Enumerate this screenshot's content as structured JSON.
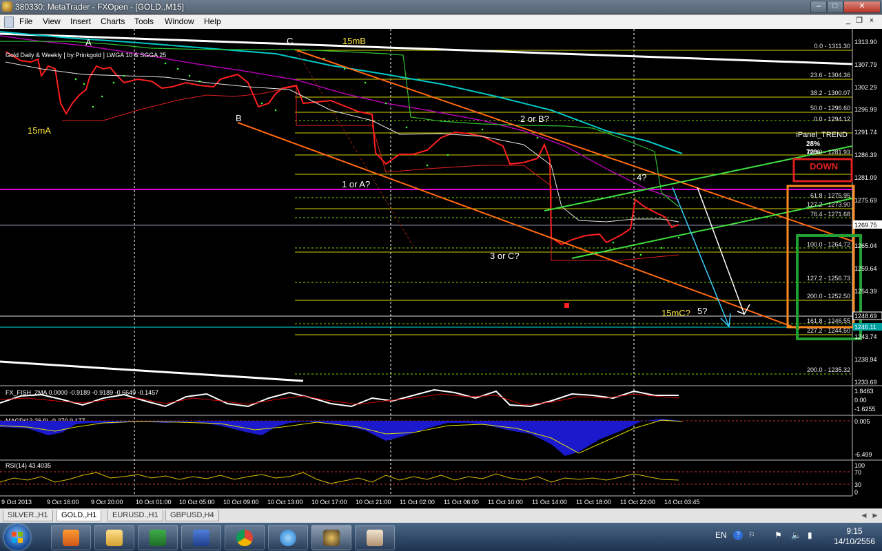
{
  "window": {
    "title": "380330: MetaTrader - FXOpen - [GOLD.,M15]",
    "min": "–",
    "max": "□",
    "close": "✕",
    "mdi_min": "_",
    "mdi_restore": "❐",
    "mdi_close": "×"
  },
  "menu": [
    "File",
    "View",
    "Insert",
    "Charts",
    "Tools",
    "Window",
    "Help"
  ],
  "chart": {
    "info": "Gold Daily & Weekly [ by:Prinkgold ] LWGA 10  & SGGA 25",
    "price_labels": [
      "1313.90",
      "1307.79",
      "1302.29",
      "1296.99",
      "1291.74",
      "1286.39",
      "1281.09",
      "1275.69",
      "1269.75",
      "1265.04",
      "1259.64",
      "1254.39",
      "1248.69",
      "1246.11",
      "1243.74",
      "1238.94",
      "1233.69"
    ],
    "current_price": "1269.75",
    "fib_labels": [
      "0.0 - 1311.30",
      "23.6 - 1304.36",
      "38.2 - 1300.07",
      "50.0 - 1296.60",
      "0.0 - 1294.12",
      "100.0 - 1281.93",
      "61.8 - 1275.95",
      "127.2 - 1273.90",
      "76.4 - 1271.68",
      "100.0 - 1264.72",
      "127.2 - 1256.73",
      "200.0 - 1252.50",
      "161.8 - 1246.55",
      "227.2 - 1244.50",
      "200.0 - 1235.32"
    ],
    "wave_labels": {
      "A": "A",
      "B": "B",
      "C": "C",
      "m15A": "15mA",
      "m15B": "15mB",
      "one_or_A": "1 or A?",
      "two_or_B": "2 or B?",
      "three_or_C": "3 or C?",
      "four": "4?",
      "m15C": "15mC?",
      "five": "5?"
    },
    "ipanel": {
      "title": "iPanel_TREND",
      "line1": "28%",
      "line2": "72%",
      "badge": "DOWN"
    },
    "time_labels": [
      "9 Oct 2013",
      "9 Oct 16:00",
      "9 Oct 20:00",
      "10 Oct 01:00",
      "10 Oct 05:00",
      "10 Oct 09:00",
      "10 Oct 13:00",
      "10 Oct 17:00",
      "10 Oct 21:00",
      "11 Oct 02:00",
      "11 Oct 06:00",
      "11 Oct 10:00",
      "11 Oct 14:00",
      "11 Oct 18:00",
      "11 Oct 22:00",
      "14 Oct 03:45"
    ],
    "indicators": {
      "fisher": {
        "label": "FX_FISH_2MA 0.0000 -0.9189 -0.9189 -0.6649 -0.1457",
        "ticks": [
          "1.8463",
          "0.00",
          "-1.6255"
        ]
      },
      "macd": {
        "label": "MACD(12,26,9) -0.270 0.177",
        "ticks": [
          "0.005",
          "-6.499"
        ]
      },
      "rsi": {
        "label": "RSI(14) 43.4035",
        "ticks": [
          "100",
          "70",
          "30",
          "0"
        ]
      }
    }
  },
  "tabs": [
    {
      "label": "SILVER.,H1",
      "active": false
    },
    {
      "label": "GOLD.,H1",
      "active": true
    },
    {
      "label": "EURUSD.,H1",
      "active": false
    },
    {
      "label": "GBPUSD,H4",
      "active": false
    }
  ],
  "tab_arrows": {
    "left": "◀",
    "right": "▶"
  },
  "taskbar": {
    "apps": [
      "media-player",
      "file-explorer",
      "excel",
      "word",
      "chrome",
      "internet-explorer",
      "metatrader",
      "paint"
    ],
    "lang": "EN",
    "time": "9:15",
    "date": "14/10/2556"
  }
}
